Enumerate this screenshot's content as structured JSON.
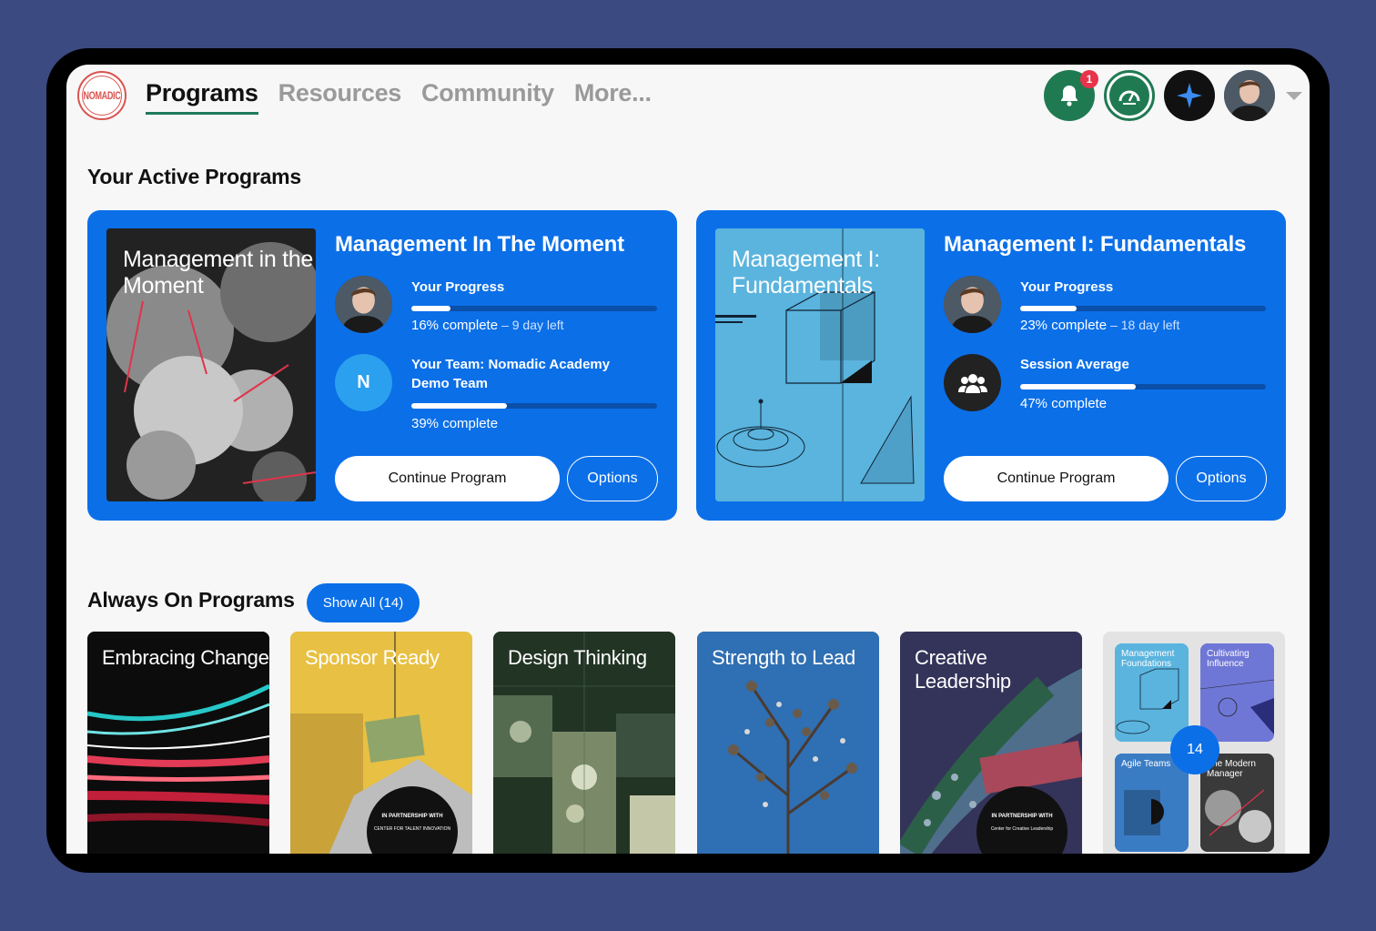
{
  "header": {
    "logo_text": "NOMADIC",
    "nav": [
      "Programs",
      "Resources",
      "Community",
      "More..."
    ],
    "notification_count": "1"
  },
  "active_section": {
    "title": "Your Active Programs"
  },
  "programs": [
    {
      "cover_title": "Management in the Moment",
      "title": "Management In The Moment",
      "progress_label": "Your Progress",
      "progress_text": "16% complete",
      "progress_sub": "– 9 day left",
      "progress": 0.16,
      "team_initial": "N",
      "team_label": "Your Team: Nomadic Academy Demo Team",
      "team_text": "39% complete",
      "team_progress": 0.39,
      "continue_label": "Continue Program",
      "options_label": "Options"
    },
    {
      "cover_title": "Management I: Fundamentals",
      "title": "Management I: Fundamentals",
      "progress_label": "Your Progress",
      "progress_text": "23% complete",
      "progress_sub": "– 18 day left",
      "progress": 0.23,
      "team_label": "Session Average",
      "team_text": "47% complete",
      "team_progress": 0.47,
      "continue_label": "Continue Program",
      "options_label": "Options"
    }
  ],
  "always_on": {
    "title": "Always On Programs",
    "show_all_label": "Show All (14)",
    "tiles": [
      "Embracing Change",
      "Sponsor Ready",
      "Design Thinking",
      "Strength to Lead",
      "Creative Leadership"
    ],
    "partner_text": "IN PARTNERSHIP WITH",
    "partner_ctl": "CENTER FOR TALENT INNOVATION",
    "partner_ccl": "Center for Creative Leadership",
    "mini_tiles": [
      "Management Foundations",
      "Cultivating Influence",
      "Agile Teams",
      "The Modern Manager"
    ],
    "count": "14"
  },
  "colors": {
    "accent": "#0b6fe8",
    "brand_green": "#1f7a52",
    "background": "#3b4a80"
  }
}
